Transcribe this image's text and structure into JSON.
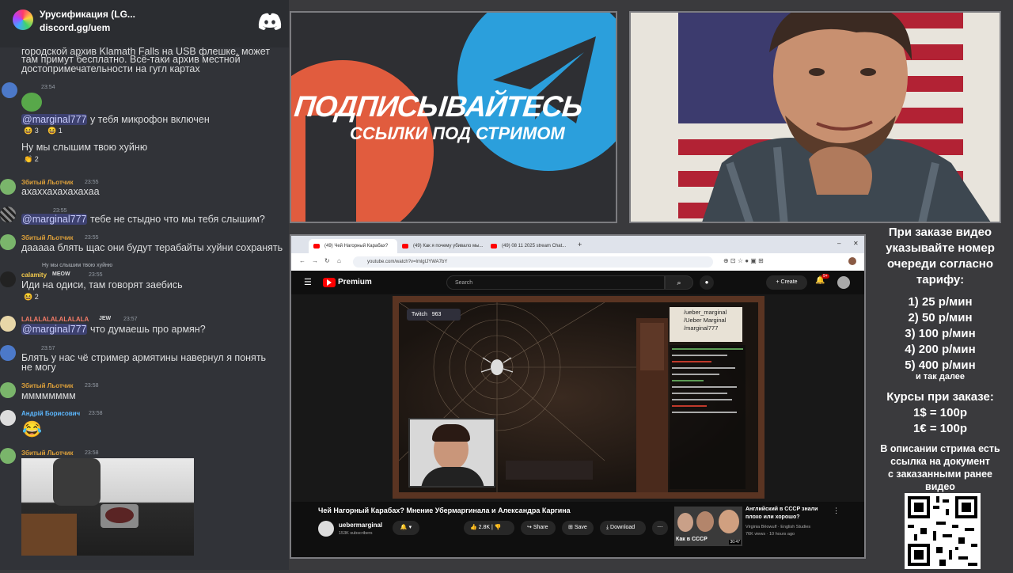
{
  "chat": {
    "server_name": "Урусификация (LG...",
    "invite": "discord.gg/uem",
    "top_text": [
      "городской архив Klamath Falls на USB флешке, может",
      "там примут бесплатно. Всё-таки архив местной",
      "достопримечательности на гугл картах"
    ],
    "messages": [
      {
        "user": "",
        "time": "23:54",
        "lines": [
          "@marginal777 у тебя микрофон включен"
        ],
        "mention": "@marginal777",
        "rest": " у тебя микрофон включен",
        "reactions": [
          "3",
          "1"
        ]
      },
      {
        "lines": [
          "Ну мы слышим твою хуйню"
        ],
        "reactions": [
          "2"
        ]
      },
      {
        "user": "Збитый Льотчик",
        "time": "23:55",
        "text": "ахаххахахахахаа"
      },
      {
        "user": "",
        "time": "23:55",
        "mention": "@marginal777",
        "rest": " тебе не стыдно что мы тебя слышим?"
      },
      {
        "user": "Збитый Льотчик",
        "time": "23:55",
        "text": "дааааа блять щас они будут терабайты хуйни сохранять"
      },
      {
        "reply": "Ну мы слышим твою хуйню",
        "user": "calamity",
        "badge": "MEOW",
        "time": "23:55",
        "text": "Иди на одиси, там говорят заебись",
        "reactions": [
          "2"
        ]
      },
      {
        "user": "LALALALALALALALA",
        "badge": "JEW",
        "time": "23:57",
        "mention": "@marginal777",
        "rest": " что думаешь про армян?"
      },
      {
        "user": "",
        "time": "23:57",
        "text1": "Блять у нас чё стример армятины навернул я понять",
        "text2": "не могу"
      },
      {
        "user": "Збитый Льотчик",
        "time": "23:58",
        "text": "мммммммм"
      },
      {
        "user": "Андрій Борисович",
        "time": "23:58"
      },
      {
        "user": "Збитый Льотчик",
        "time": "23:58"
      }
    ]
  },
  "promo": {
    "title": "ПОДПИСЫВАЙТЕСЬ",
    "subtitle": "ССЫЛКИ ПОД СТРИМОМ"
  },
  "browser": {
    "tabs": [
      "(49) Чей Нагорный Карабах?",
      "(49) Как я почему убивало мы...",
      "(49) 08 11 2025 stream Chat..."
    ],
    "url": "youtube.com/watch?v=lmlgIJYWA7bY",
    "yt_logo": "Premium",
    "search_placeholder": "Search",
    "create": "Create",
    "notif_count": "9+",
    "twitch_label": "Twitch",
    "twitch_viewers": "963",
    "socials": [
      "/ueber_marginal",
      "/Ueber Marginal",
      "/marginal777"
    ],
    "video_title": "Чей Нагорный Карабах? Мнение Убермаргинала и Александра Каргина",
    "channel": "uebermarginal",
    "subs": "153K subscribers",
    "likes": "2.8K",
    "share": "Share",
    "save": "Save",
    "download": "Download",
    "rec_title1": "Английский в СССР знали",
    "rec_title2": "плохо или хорошо?",
    "rec_channel": "Virginia Bēowulf · English Studies",
    "rec_meta": "76K views · 10 hours ago",
    "rec_thumb": "Как в СССР",
    "rec_duration": "30:47"
  },
  "info": {
    "lines": [
      "При заказе видео",
      "указывайте номер",
      "очереди согласно",
      "тарифу:"
    ],
    "tariffs": [
      "1) 25 р/мин",
      "2) 50 р/мин",
      "3) 100 р/мин",
      "4) 200 р/мин",
      "5) 400 р/мин"
    ],
    "etc": "и так далее",
    "courses": "Курсы при заказе:",
    "rates": [
      "1$ = 100р",
      "1€ = 100р"
    ],
    "desc": [
      "В описании стрима есть",
      "ссылка на документ",
      "с заказанными ранее",
      "видео"
    ]
  }
}
